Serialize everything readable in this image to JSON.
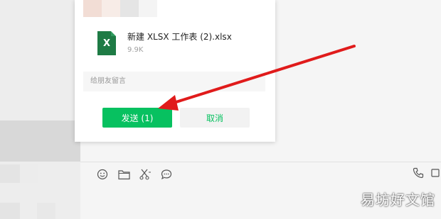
{
  "dialog": {
    "file_name": "新建 XLSX 工作表 (2).xlsx",
    "file_size": "9.9K",
    "file_icon_letter": "X",
    "message_placeholder": "给朋友留言",
    "send_label": "发送 (1)",
    "cancel_label": "取消"
  },
  "toolbar": {
    "icons": [
      "emoji-icon",
      "folder-icon",
      "scissors-icon",
      "chat-bubble-icon"
    ],
    "right_icons": [
      "phone-icon",
      "video-icon"
    ]
  },
  "watermark": "易坊好文馆",
  "colors": {
    "accent": "#07c160",
    "excel_green": "#1e7b45",
    "arrow": "#e01b1b"
  }
}
